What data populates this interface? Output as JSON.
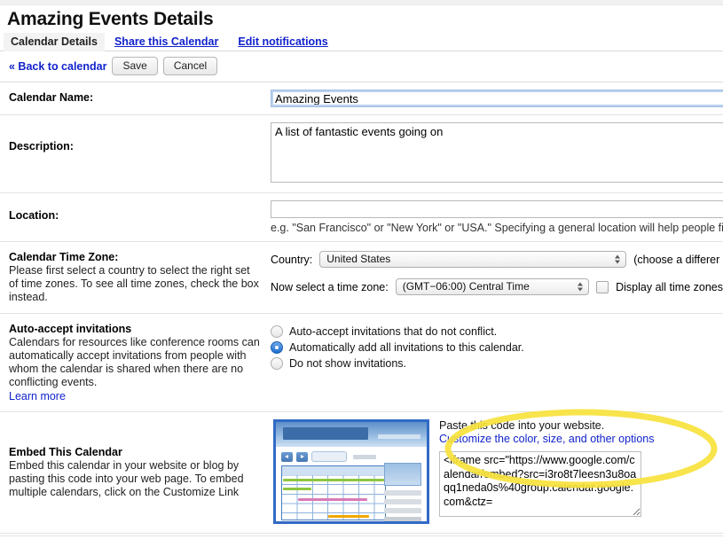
{
  "header": {
    "title": "Amazing Events Details",
    "tabs": [
      {
        "label": "Calendar Details",
        "active": true
      },
      {
        "label": "Share this Calendar",
        "active": false
      },
      {
        "label": "Edit notifications",
        "active": false
      }
    ]
  },
  "actionbar": {
    "back_label": "« Back to calendar",
    "save_label": "Save",
    "cancel_label": "Cancel"
  },
  "fields": {
    "calendar_name": {
      "label": "Calendar Name:",
      "value": "Amazing Events",
      "placeholder": ""
    },
    "description": {
      "label": "Description:",
      "value": "A list of fantastic events going on",
      "placeholder": ""
    },
    "location": {
      "label": "Location:",
      "value": "",
      "placeholder": "",
      "hint": "e.g. \"San Francisco\" or \"New York\" or \"USA.\" Specifying a general location will help people find e"
    }
  },
  "timezone": {
    "label": "Calendar Time Zone:",
    "description": "Please first select a country to select the right set of time zones. To see all time zones, check the box instead.",
    "country_label": "Country:",
    "country_value": "United States",
    "country_note": "(choose a differer",
    "tz_label": "Now select a time zone:",
    "tz_value": "(GMT−06:00) Central Time",
    "display_all_label": "Display all time zones",
    "display_all_checked": false
  },
  "autoaccept": {
    "label": "Auto-accept invitations",
    "description": "Calendars for resources like conference rooms can automatically accept invitations from people with whom the calendar is shared when there are no conflicting events.",
    "learn_more": "Learn more",
    "options": [
      {
        "label": "Auto-accept invitations that do not conflict.",
        "selected": false
      },
      {
        "label": "Automatically add all invitations to this calendar.",
        "selected": true
      },
      {
        "label": "Do not show invitations.",
        "selected": false
      }
    ]
  },
  "embed": {
    "label": "Embed This Calendar",
    "description": "Embed this calendar in your website or blog by pasting this code into your web page. To embed multiple calendars, click on the Customize Link",
    "paste_note": "Paste this code into your website.",
    "customize_link": "Customize the color, size, and other options",
    "code": "<iframe src=\"https://www.google.com/calendar/embed?src=i3ro8t7leesn3u8oaqq1neda0s%40group.calendar.google.com&ctz="
  },
  "colors": {
    "link": "#1122cc",
    "accent": "#316ac5",
    "annotation": "#f7e23c",
    "radio_on": "#1e6fd0"
  }
}
